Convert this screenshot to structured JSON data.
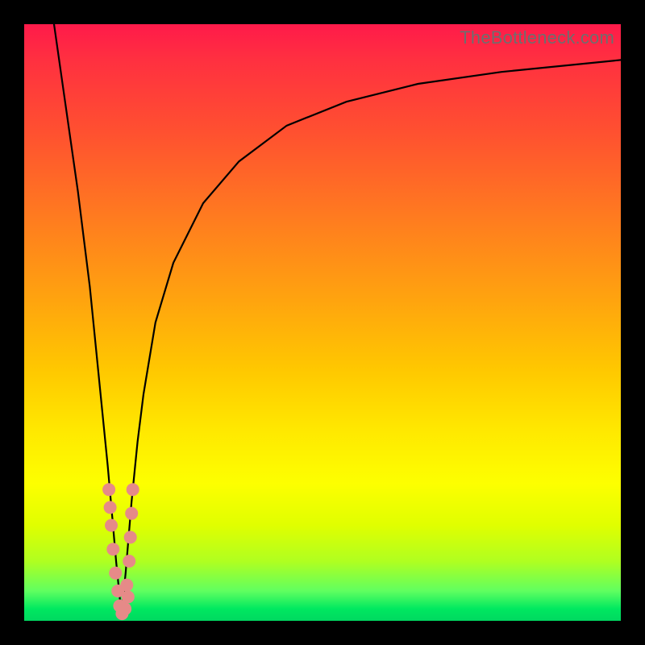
{
  "watermark": "TheBottleneck.com",
  "colors": {
    "frame": "#000000",
    "curve": "#000000",
    "dots": "#e68a88",
    "gradient_top": "#ff1a4a",
    "gradient_bottom": "#00d860"
  },
  "chart_data": {
    "type": "line",
    "title": "",
    "xlabel": "",
    "ylabel": "",
    "xlim": [
      0,
      100
    ],
    "ylim": [
      0,
      100
    ],
    "grid": false,
    "legend": false,
    "notes": "Two black curves on a vertical red→green gradient. Left curve drops from top-left to a minimum near x≈16 then the right curve rises sharply and asymptotically levels off toward the top-right. Cluster of salmon dots sits around the minimum where the two curves meet.",
    "series": [
      {
        "name": "left-branch",
        "x": [
          5,
          7,
          9,
          11,
          12,
          13,
          14,
          14.8,
          15.4,
          15.9,
          16.3
        ],
        "y": [
          100,
          86,
          72,
          56,
          46,
          36,
          26,
          17,
          10,
          5,
          1
        ]
      },
      {
        "name": "right-branch",
        "x": [
          16.3,
          17,
          18,
          19,
          20,
          22,
          25,
          30,
          36,
          44,
          54,
          66,
          80,
          100
        ],
        "y": [
          1,
          8,
          20,
          30,
          38,
          50,
          60,
          70,
          77,
          83,
          87,
          90,
          92,
          94
        ]
      }
    ],
    "marker_cluster": {
      "name": "data-points-near-minimum",
      "points": [
        {
          "x": 14.2,
          "y": 22
        },
        {
          "x": 14.4,
          "y": 19
        },
        {
          "x": 14.6,
          "y": 16
        },
        {
          "x": 14.9,
          "y": 12
        },
        {
          "x": 15.3,
          "y": 8
        },
        {
          "x": 15.7,
          "y": 5
        },
        {
          "x": 16.0,
          "y": 2.5
        },
        {
          "x": 16.4,
          "y": 1.2
        },
        {
          "x": 16.9,
          "y": 2
        },
        {
          "x": 17.4,
          "y": 4
        },
        {
          "x": 18.2,
          "y": 22
        },
        {
          "x": 18.0,
          "y": 18
        },
        {
          "x": 17.8,
          "y": 14
        },
        {
          "x": 17.6,
          "y": 10
        },
        {
          "x": 17.2,
          "y": 6
        }
      ]
    }
  }
}
